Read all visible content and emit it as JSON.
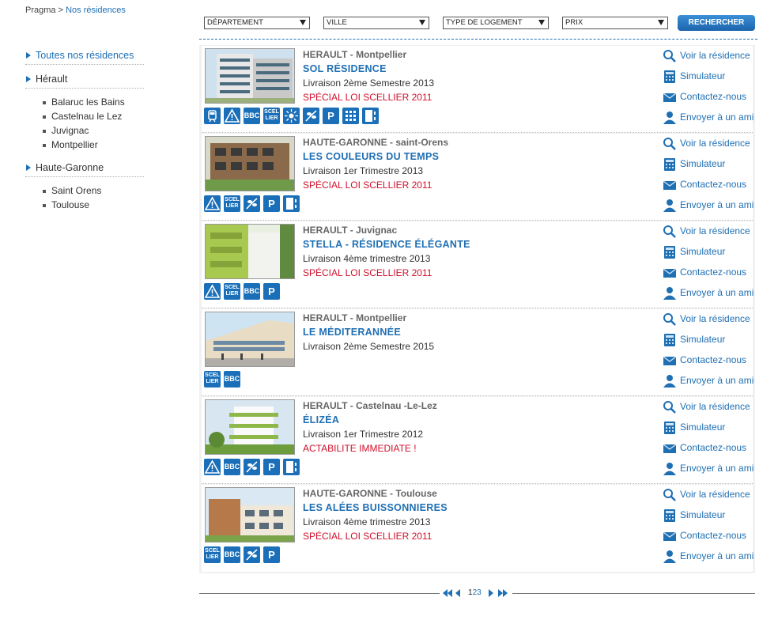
{
  "breadcrumb": {
    "root": "Pragma",
    "separator": ">",
    "current": "Nos résidences"
  },
  "sidebar": {
    "all_label": "Toutes nos résidences",
    "regions": [
      {
        "label": "Hérault",
        "cities": [
          "Balaruc les Bains",
          "Castelnau le Lez",
          "Juvignac",
          "Montpellier"
        ]
      },
      {
        "label": "Haute-Garonne",
        "cities": [
          "Saint Orens",
          "Toulouse"
        ]
      }
    ]
  },
  "filters": {
    "departement": "DÉPARTEMENT",
    "ville": "VILLE",
    "type": "TYPE DE LOGEMENT",
    "prix": "PRIX",
    "search": "RECHERCHER"
  },
  "actions": {
    "view": "Voir la résidence",
    "simulator": "Simulateur",
    "contact": "Contactez-nous",
    "send": "Envoyer à un ami"
  },
  "residences": [
    {
      "region": "HERAULT",
      "city": "Montpellier",
      "name": "SOL RÉSIDENCE",
      "delivery": "Livraison 2ème Semestre 2013",
      "promo": "SPÉCIAL LOI SCELLIER 2011",
      "icons": [
        "tram-icon",
        "warning-icon",
        "bbc-icon",
        "scellier-icon",
        "sun-icon",
        "garden-icon",
        "parking-icon",
        "grid-icon",
        "door-icon"
      ]
    },
    {
      "region": "HAUTE-GARONNE",
      "city": "saint-Orens",
      "name": "LES COULEURS DU TEMPS",
      "delivery": "Livraison 1er Trimestre 2013",
      "promo": "SPÉCIAL LOI SCELLIER 2011",
      "icons": [
        "warning-icon",
        "scellier-icon",
        "garden-icon",
        "parking-icon",
        "door-icon"
      ]
    },
    {
      "region": "HERAULT",
      "city": "Juvignac",
      "name": "STELLA - RÉSIDENCE ÉLÉGANTE",
      "delivery": "Livraison 4ème trimestre 2013",
      "promo": "SPÉCIAL LOI SCELLIER 2011",
      "icons": [
        "warning-icon",
        "scellier-icon",
        "bbc-icon",
        "parking-icon"
      ]
    },
    {
      "region": "HERAULT",
      "city": "Montpellier",
      "name": "LE MÉDITERANNÉE",
      "delivery": "Livraison 2ème Semestre 2015",
      "promo": "",
      "icons": [
        "scellier-icon",
        "bbc-icon"
      ]
    },
    {
      "region": "HERAULT",
      "city": "Castelnau -Le-Lez",
      "name": "ÉLIZÉA",
      "delivery": "Livraison 1er Trimestre 2012",
      "promo": "ACTABILITE IMMEDIATE !",
      "icons": [
        "warning-icon",
        "bbc-icon",
        "garden-icon",
        "parking-icon",
        "door-icon"
      ]
    },
    {
      "region": "HAUTE-GARONNE",
      "city": "Toulouse",
      "name": "LES ALÉES BUISSONNIERES",
      "delivery": "Livraison 4ème trimestre 2013",
      "promo": "SPÉCIAL LOI SCELLIER 2011",
      "icons": [
        "scellier-icon",
        "bbc-icon",
        "garden-icon",
        "parking-icon"
      ]
    }
  ],
  "icon_labels": {
    "bbc": "BBC",
    "parking": "P",
    "scellier_1": "SCEL",
    "scellier_2": "LIER"
  },
  "pagination": {
    "pages": [
      "1",
      "2",
      "3"
    ],
    "current": "1"
  },
  "colors": {
    "accent": "#1f6fb3",
    "promo": "#d0102c",
    "icon_bg": "#1a6fb8"
  }
}
